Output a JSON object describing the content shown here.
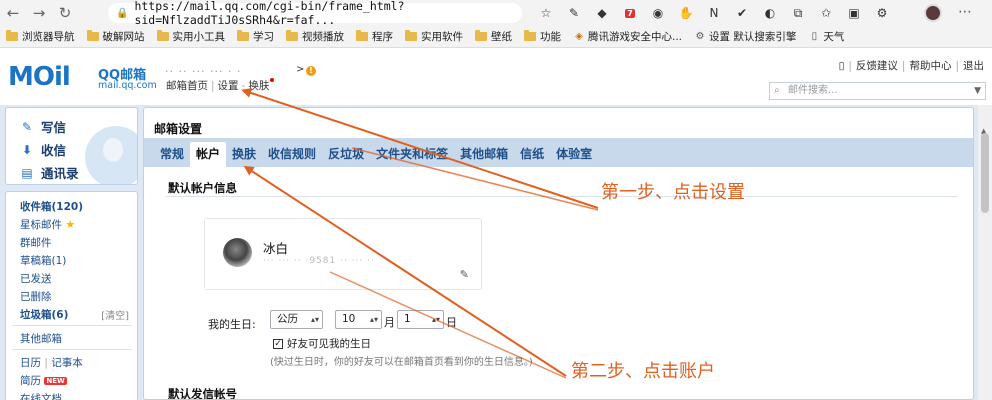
{
  "browser": {
    "url": "https://mail.qq.com/cgi-bin/frame_html?sid=NflzaddTiJ0sSRh4&r=faf...",
    "ext_badge": "7"
  },
  "bookmarks": [
    {
      "label": "浏览器导航"
    },
    {
      "label": "破解网站"
    },
    {
      "label": "实用小工具"
    },
    {
      "label": "学习"
    },
    {
      "label": "视频播放"
    },
    {
      "label": "程序"
    },
    {
      "label": "实用软件"
    },
    {
      "label": "壁纸"
    },
    {
      "label": "功能"
    },
    {
      "label": "腾讯游戏安全中心..."
    },
    {
      "label": "设置 默认搜索引擎"
    },
    {
      "label": "天气"
    }
  ],
  "header": {
    "logo": "MOil",
    "logo_name": "QQ邮箱",
    "logo_domain": "mail.qq.com",
    "account_masked": "·· ·· ··· ··· · ·",
    "links": [
      "邮箱首页",
      "设置",
      "换肤"
    ],
    "top_links": [
      "反馈建议",
      "帮助中心",
      "退出"
    ],
    "search_placeholder": "邮件搜索..."
  },
  "sidebar": {
    "actions": [
      "写信",
      "收信",
      "通讯录"
    ],
    "folders": [
      {
        "label": "收件箱(120)",
        "bold": true
      },
      {
        "label": "星标邮件"
      },
      {
        "label": "群邮件"
      },
      {
        "label": "草稿箱(1)"
      },
      {
        "label": "已发送"
      },
      {
        "label": "已删除"
      },
      {
        "label": "垃圾箱(6)",
        "bold": true
      }
    ],
    "clear_label": "[清空]",
    "other": "其他邮箱",
    "calendar": "日历",
    "notes": "记事本",
    "resume": "简历",
    "new_tag": "NEW",
    "docs": "在线文档"
  },
  "main": {
    "title": "邮箱设置",
    "tabs": [
      "常规",
      "帐户",
      "换肤",
      "收信规则",
      "反垃圾",
      "文件夹和标签",
      "其他邮箱",
      "信纸",
      "体验室"
    ],
    "active_tab": 1,
    "section_title": "默认帐户信息",
    "card": {
      "name": "冰白",
      "email_masked": "··· ··· ·· ·9581 ·· ··· ··"
    },
    "birthday_label": "我的生日:",
    "calendar_type": "公历",
    "month": "10",
    "month_unit": "月",
    "day": "1",
    "day_unit": "日",
    "friends_visible": "好友可见我的生日",
    "hint": "(快过生日时，你的好友可以在邮箱首页看到你的生日信息。)",
    "section2_title": "默认发信帐号"
  },
  "annotations": {
    "step1": "第一步、点击设置",
    "step2": "第二步、点击账户"
  },
  "colors": {
    "accent": "#1b74c5",
    "annotation": "#e06020",
    "tab_bar": "#c8d9ec"
  }
}
